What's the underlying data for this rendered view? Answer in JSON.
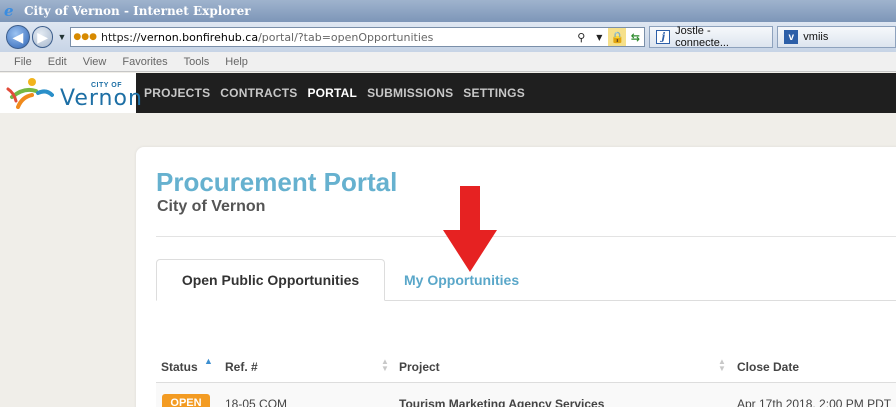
{
  "window": {
    "title": "City of Vernon - Internet Explorer"
  },
  "address": {
    "protocol": "https://",
    "domain": "vernon.bonfirehub.ca",
    "path": "/portal/?tab=openOpportunities"
  },
  "browser_tabs": [
    {
      "label": "Jostle - connecte...",
      "icon": "jostle-icon"
    },
    {
      "label": "vmiis",
      "icon": "vmiis-icon"
    }
  ],
  "menu": [
    "File",
    "Edit",
    "View",
    "Favorites",
    "Tools",
    "Help"
  ],
  "logo": {
    "city_of": "CITY OF",
    "name": "Vernon"
  },
  "nav": {
    "items": [
      "PROJECTS",
      "CONTRACTS",
      "PORTAL",
      "SUBMISSIONS",
      "SETTINGS"
    ],
    "active": "PORTAL"
  },
  "page": {
    "title": "Procurement Portal",
    "subtitle": "City of Vernon"
  },
  "tabs": {
    "open": "Open Public Opportunities",
    "mine": "My Opportunities"
  },
  "table": {
    "headers": {
      "status": "Status",
      "ref": "Ref. #",
      "project": "Project",
      "close": "Close Date"
    },
    "rows": [
      {
        "status": "OPEN",
        "ref": "18-05 COM",
        "project": "Tourism Marketing Agency Services",
        "close": "Apr 17th 2018, 2:00 PM PDT"
      }
    ]
  },
  "colors": {
    "accent": "#66b1cf",
    "open_badge": "#f39b22",
    "arrow": "#e62222",
    "nav_bg": "#1f1f1f"
  }
}
